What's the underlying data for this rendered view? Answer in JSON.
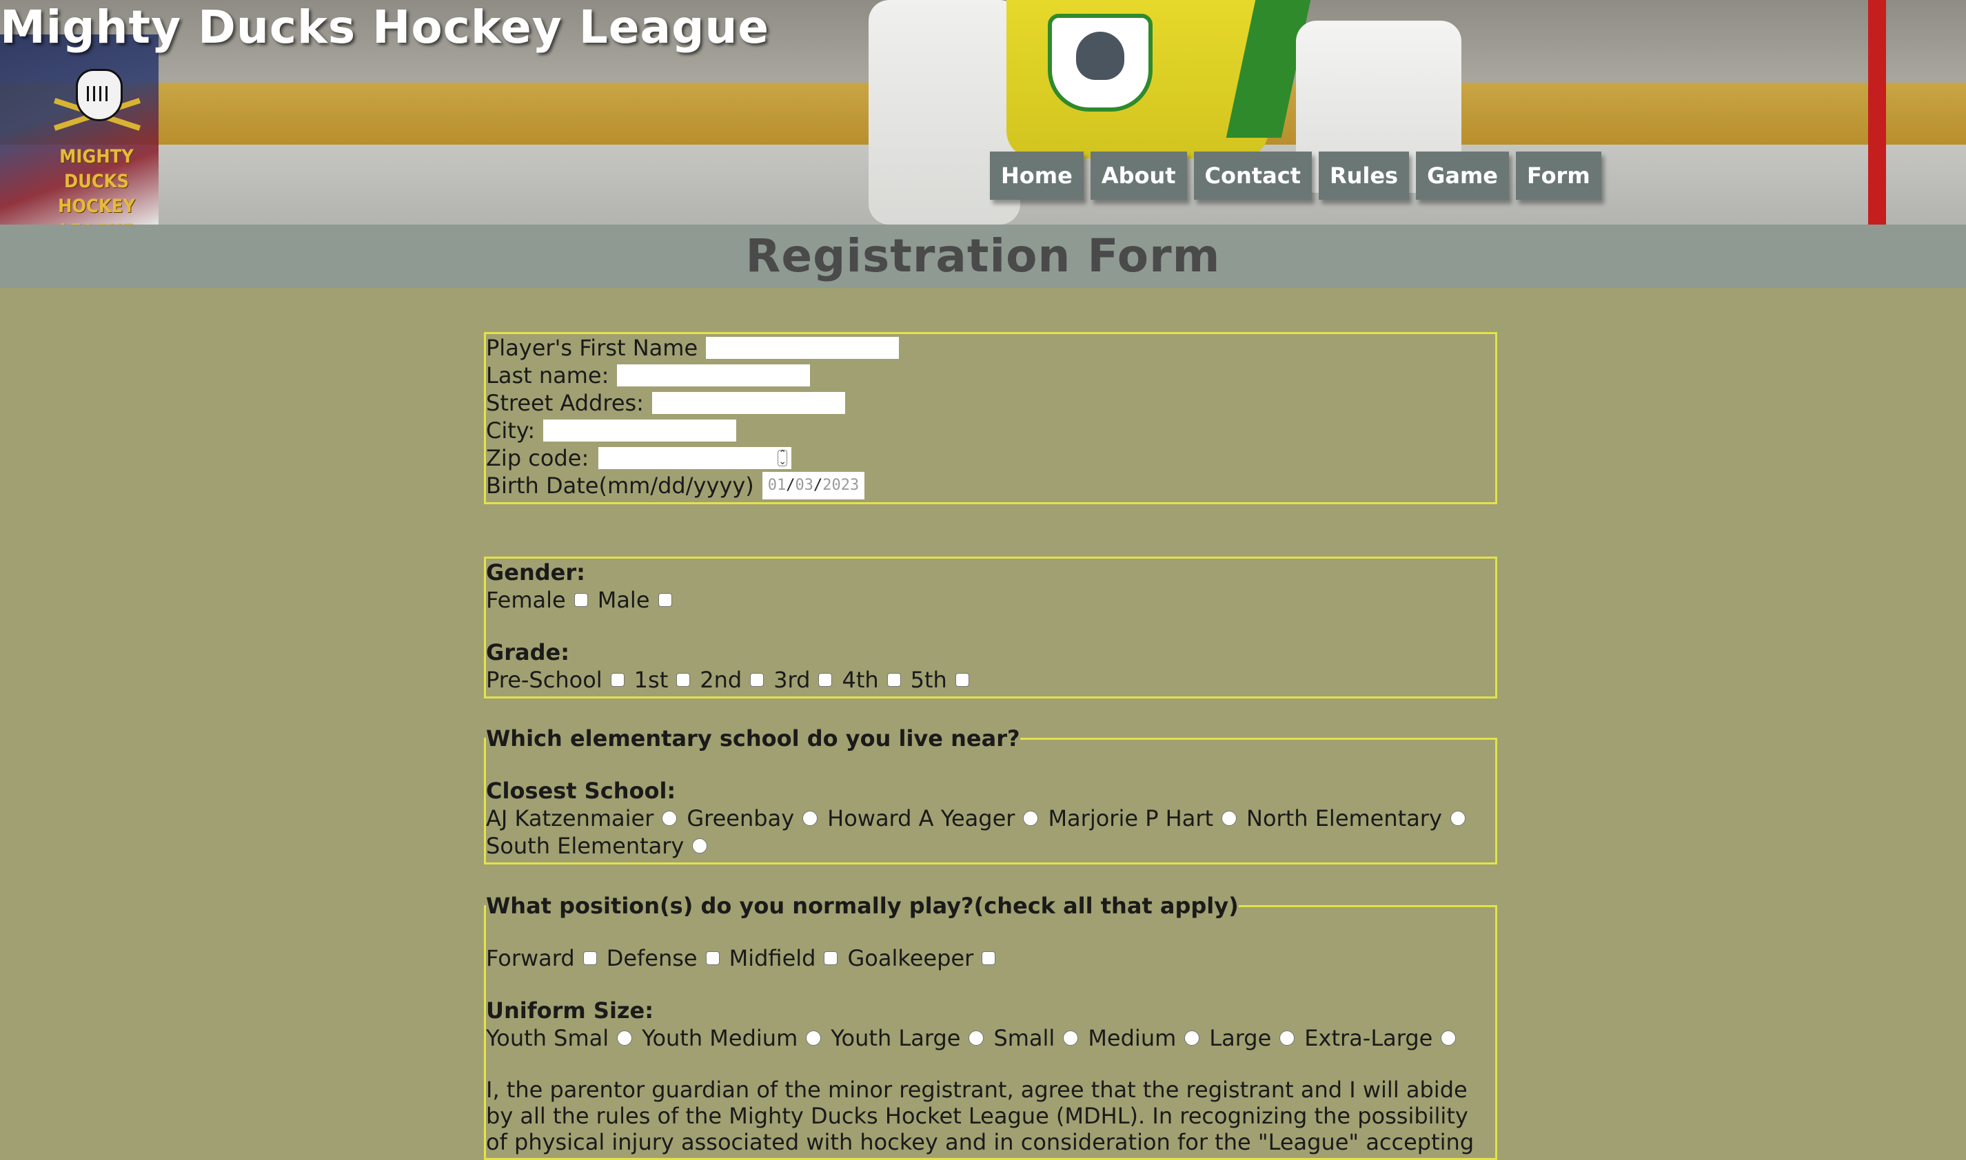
{
  "site": {
    "title": "Mighty Ducks Hockey League",
    "logo_line1": "MIGHTY DUCKS",
    "logo_line2": "HOCKEY LEAGUE"
  },
  "nav": {
    "items": [
      "Home",
      "About",
      "Contact",
      "Rules",
      "Game",
      "Form"
    ]
  },
  "page": {
    "heading": "Registration Form"
  },
  "personal": {
    "first_name_label": "Player's First Name",
    "last_name_label": "Last name:",
    "street_label": "Street Addres:",
    "city_label": "City:",
    "zip_label": "Zip code:",
    "birth_label": "Birth Date(mm/dd/yyyy)",
    "birth_mm": "01",
    "birth_dd": "03",
    "birth_yyyy": "2023"
  },
  "gender": {
    "heading": "Gender:",
    "options": [
      "Female",
      "Male"
    ]
  },
  "grade": {
    "heading": "Grade:",
    "options": [
      "Pre-School",
      "1st",
      "2nd",
      "3rd",
      "4th",
      "5th"
    ]
  },
  "school": {
    "legend": "Which elementary school do you live near?",
    "heading": "Closest School:",
    "options": [
      "AJ Katzenmaier",
      "Greenbay",
      "Howard A Yeager",
      "Marjorie P Hart",
      "North Elementary",
      "South Elementary"
    ]
  },
  "position": {
    "legend": "What position(s) do you normally play?(check all that apply)",
    "options": [
      "Forward",
      "Defense",
      "Midfield",
      "Goalkeeper"
    ]
  },
  "uniform": {
    "heading": "Uniform Size:",
    "options": [
      "Youth Smal",
      "Youth Medium",
      "Youth Large",
      "Small",
      "Medium",
      "Large",
      "Extra-Large"
    ]
  },
  "waiver": {
    "text": "I, the parentor guardian of the minor registrant, agree that the registrant and I will abide by all the rules of the Mighty Ducks Hocket League (MDHL). In recognizing the possibility of physical injury associated with hockey and in consideration for the \"League\" accepting"
  },
  "colors": {
    "page_bg": "#a0a072",
    "title_bar": "#8f9a93",
    "nav_bg": "#6b7775",
    "fieldset_border": "#e3e24a",
    "logo_gold": "#e8b93a"
  }
}
